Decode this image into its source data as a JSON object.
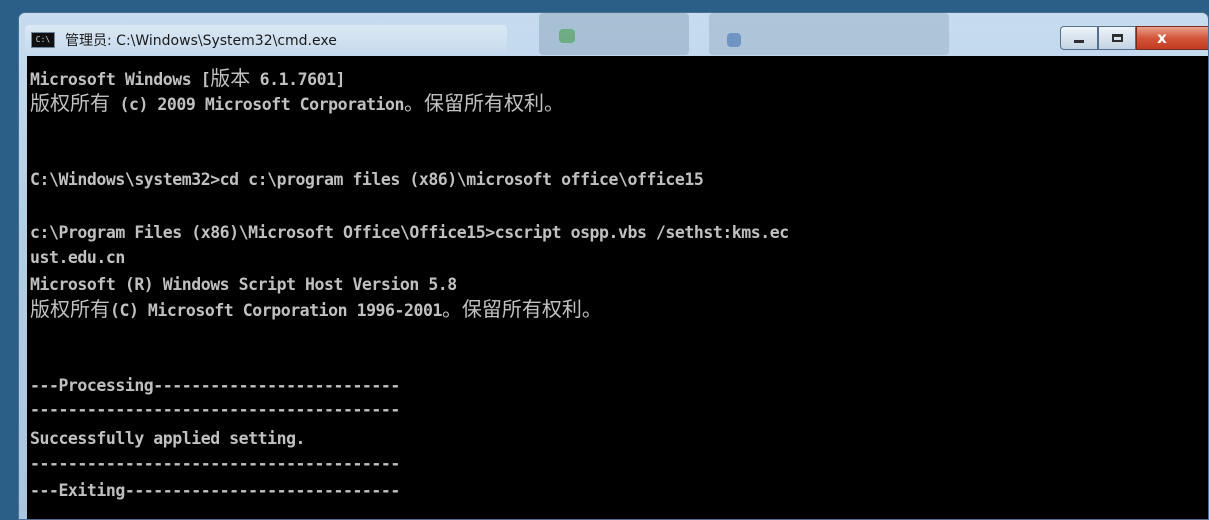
{
  "window": {
    "title": "管理员: C:\\Windows\\System32\\cmd.exe",
    "icon_label": "C:\\",
    "controls": {
      "minimize": "minimize",
      "maximize": "maximize",
      "close": "x"
    }
  },
  "console": {
    "lines": [
      "Microsoft Windows [版本 6.1.7601]",
      "版权所有 (c) 2009 Microsoft Corporation。保留所有权利。",
      "",
      "C:\\Windows\\system32>cd c:\\program files (x86)\\microsoft office\\office15",
      "",
      "c:\\Program Files (x86)\\Microsoft Office\\Office15>cscript ospp.vbs /sethst:kms.ec",
      "ust.edu.cn",
      "Microsoft (R) Windows Script Host Version 5.8",
      "版权所有(C) Microsoft Corporation 1996-2001。保留所有权利。",
      "",
      "---Processing--------------------------",
      "---------------------------------------",
      "Successfully applied setting.",
      "---------------------------------------",
      "---Exiting-----------------------------"
    ]
  },
  "colors": {
    "console_bg": "#000000",
    "console_text": "#c0c0c0",
    "close_button": "#c23c20"
  }
}
